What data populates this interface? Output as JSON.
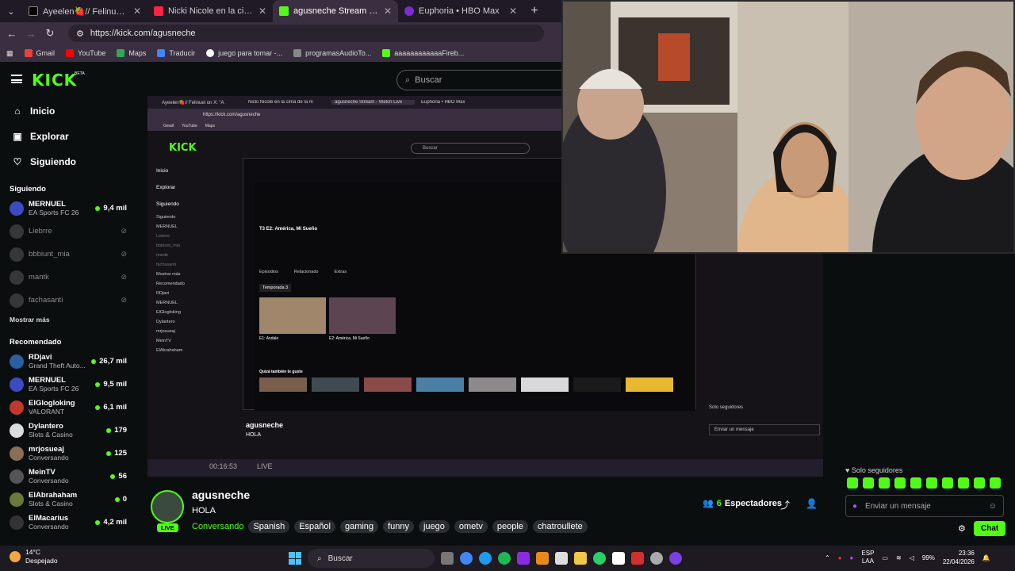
{
  "browser": {
    "tabs": [
      {
        "title": "Ayeelen🍓// Felinuel on X: \"A",
        "active": false
      },
      {
        "title": "Nicki Nicole en la cima de la m",
        "active": false
      },
      {
        "title": "agusneche Stream - Watch Live",
        "active": true
      },
      {
        "title": "Euphoria • HBO Max",
        "active": false
      }
    ],
    "url": "https://kick.com/agusneche",
    "bookmarks": [
      "Gmail",
      "YouTube",
      "Maps",
      "Traducir",
      "juego para tomar -...",
      "programasAudioTo...",
      "aaaaaaaaaaaaFireb..."
    ]
  },
  "kick": {
    "logo": "KICK",
    "beta": "BETA",
    "search_placeholder": "Buscar",
    "nav": [
      "Inicio",
      "Explorar",
      "Siguiendo"
    ],
    "following_title": "Siguiendo",
    "following": [
      {
        "name": "MERNUEL",
        "category": "EA Sports FC 26",
        "viewers": "9,4 mil",
        "live": true
      },
      {
        "name": "Liebrre",
        "live": false
      },
      {
        "name": "bbbiunt_mia",
        "live": false
      },
      {
        "name": "mantk",
        "live": false
      },
      {
        "name": "fachasanti",
        "live": false
      }
    ],
    "show_more": "Mostrar más",
    "recommended_title": "Recomendado",
    "recommended": [
      {
        "name": "RDjavi",
        "category": "Grand Theft Auto...",
        "viewers": "26,7 mil"
      },
      {
        "name": "MERNUEL",
        "category": "EA Sports FC 26",
        "viewers": "9,5 mil"
      },
      {
        "name": "ElGlogloking",
        "category": "VALORANT",
        "viewers": "6,1 mil"
      },
      {
        "name": "Dylantero",
        "category": "Slots & Casino",
        "viewers": "179"
      },
      {
        "name": "mrjosueaj",
        "category": "Conversando",
        "viewers": "125"
      },
      {
        "name": "MeinTV",
        "category": "Conversando",
        "viewers": "56"
      },
      {
        "name": "ElAbrahaham",
        "category": "Slots & Casino",
        "viewers": "0"
      },
      {
        "name": "ElMacarius",
        "category": "Conversando",
        "viewers": "4,2 mil"
      }
    ]
  },
  "stream": {
    "streamer": "agusneche",
    "live_label": "LIVE",
    "title": "HOLA",
    "category": "Conversando",
    "tags": [
      "Spanish",
      "Español",
      "gaming",
      "funny",
      "juego",
      "ometv",
      "people",
      "chatroullete"
    ],
    "viewers": "6",
    "viewers_label": "Espectadores"
  },
  "nested": {
    "hbo_episode": "T3 E2: América, Mi Sueño",
    "hbo_tabs": [
      "Episodios",
      "Relacionado",
      "Extras"
    ],
    "season": "Temporada 3",
    "ep1": "E1: Andale",
    "ep2": "E2: América, Mi Sueño",
    "also": "Quizá también te guste",
    "overlay_time": "00:16:53",
    "overlay_live": "LIVE"
  },
  "chat": {
    "followers_only": "Solo seguidores",
    "placeholder": "Enviar un mensaje",
    "button": "Chat"
  },
  "taskbar": {
    "temp": "14°C",
    "weather": "Despejado",
    "search": "Buscar",
    "lang": "ESP",
    "lang2": "LAA",
    "battery": "99%",
    "time": "23:36",
    "date": "22/04/2026"
  }
}
